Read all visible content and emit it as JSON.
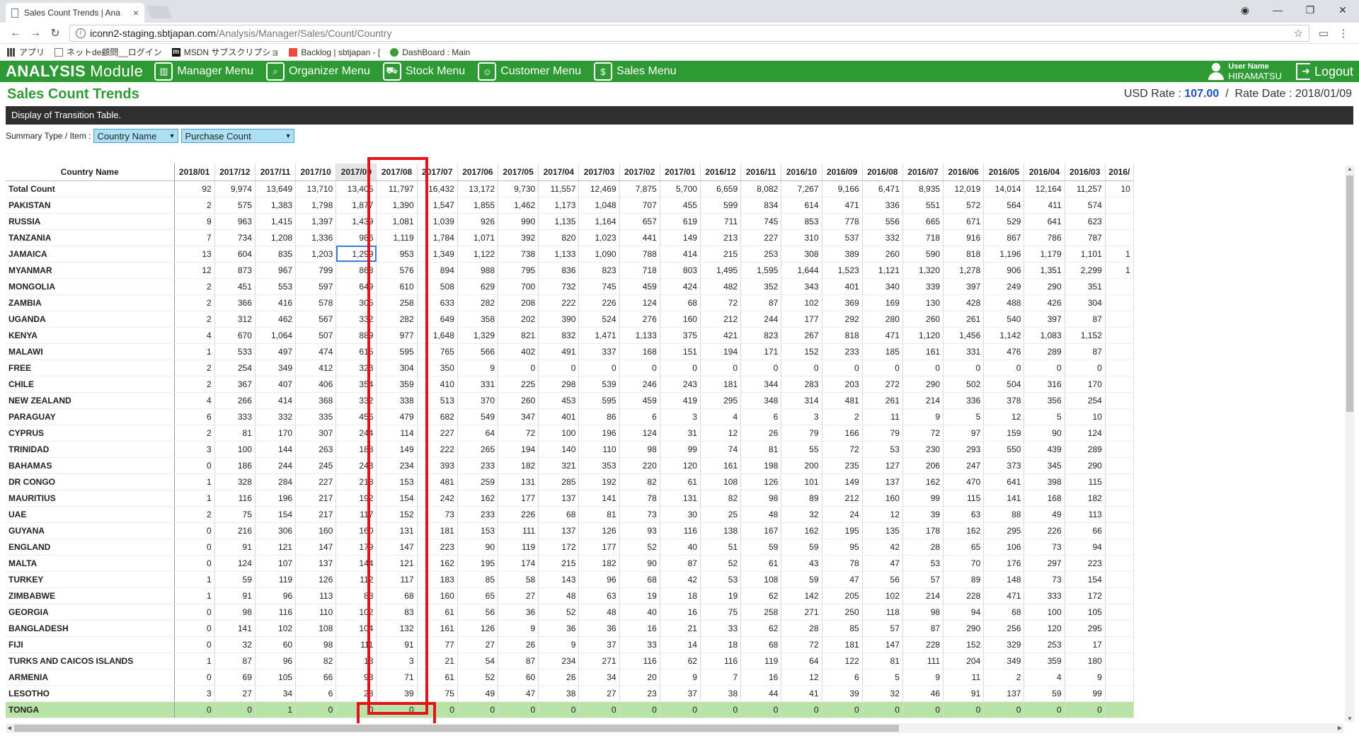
{
  "browser": {
    "tab_title": "Sales Count Trends | Ana",
    "tab_close": "×",
    "url_host": "iconn2-staging.sbtjapan.com",
    "url_path": "/Analysis/Manager/Sales/Count/Country",
    "bookmarks": [
      "アプリ",
      "ネットde顧問__ログイン",
      "MSDN サブスクリプショ",
      "Backlog | sbtjapan - [",
      "DashBoard : Main"
    ]
  },
  "app": {
    "brand": "ANALYSIS",
    "brand_sub": "Module",
    "menu": [
      "Manager Menu",
      "Organizer Menu",
      "Stock Menu",
      "Customer Menu",
      "Sales Menu"
    ],
    "user_label": "User Name",
    "user_name": "HIRAMATSU",
    "logout": "Logout"
  },
  "page": {
    "title": "Sales Count Trends",
    "usd_label": "USD Rate :",
    "usd_value": "107.00",
    "separator": "/",
    "rate_date_label": "Rate Date :",
    "rate_date_value": "2018/01/09",
    "banner": "Display of Transition Table.",
    "summary_label": "Summary Type / Item :",
    "summary_type": "Country Name",
    "summary_item": "Purchase Count"
  },
  "table": {
    "country_header": "Country Name",
    "columns": [
      "2018/01",
      "2017/12",
      "2017/11",
      "2017/10",
      "2017/09",
      "2017/08",
      "2017/07",
      "2017/06",
      "2017/05",
      "2017/04",
      "2017/03",
      "2017/02",
      "2017/01",
      "2016/12",
      "2016/11",
      "2016/10",
      "2016/09",
      "2016/08",
      "2016/07",
      "2016/06",
      "2016/05",
      "2016/04",
      "2016/03",
      "2016/"
    ],
    "rows": [
      {
        "name": "Total Count",
        "values": [
          "92",
          "9,974",
          "13,649",
          "13,710",
          "13,405",
          "11,797",
          "16,432",
          "13,172",
          "9,730",
          "11,557",
          "12,469",
          "7,875",
          "5,700",
          "6,659",
          "8,082",
          "7,267",
          "9,166",
          "6,471",
          "8,935",
          "12,019",
          "14,014",
          "12,164",
          "11,257",
          "10"
        ]
      },
      {
        "name": "PAKISTAN",
        "values": [
          "2",
          "575",
          "1,383",
          "1,798",
          "1,877",
          "1,390",
          "1,547",
          "1,855",
          "1,462",
          "1,173",
          "1,048",
          "707",
          "455",
          "599",
          "834",
          "614",
          "471",
          "336",
          "551",
          "572",
          "564",
          "411",
          "574",
          ""
        ]
      },
      {
        "name": "RUSSIA",
        "values": [
          "9",
          "963",
          "1,415",
          "1,397",
          "1,439",
          "1,081",
          "1,039",
          "926",
          "990",
          "1,135",
          "1,164",
          "657",
          "619",
          "711",
          "745",
          "853",
          "778",
          "556",
          "665",
          "671",
          "529",
          "641",
          "623",
          ""
        ]
      },
      {
        "name": "TANZANIA",
        "values": [
          "7",
          "734",
          "1,208",
          "1,336",
          "986",
          "1,119",
          "1,784",
          "1,071",
          "392",
          "820",
          "1,023",
          "441",
          "149",
          "213",
          "227",
          "310",
          "537",
          "332",
          "718",
          "916",
          "867",
          "786",
          "787",
          ""
        ]
      },
      {
        "name": "JAMAICA",
        "values": [
          "13",
          "604",
          "835",
          "1,203",
          "1,299",
          "953",
          "1,349",
          "1,122",
          "738",
          "1,133",
          "1,090",
          "788",
          "414",
          "215",
          "253",
          "308",
          "389",
          "260",
          "590",
          "818",
          "1,196",
          "1,179",
          "1,101",
          "1"
        ]
      },
      {
        "name": "MYANMAR",
        "values": [
          "12",
          "873",
          "967",
          "799",
          "868",
          "576",
          "894",
          "988",
          "795",
          "836",
          "823",
          "718",
          "803",
          "1,495",
          "1,595",
          "1,644",
          "1,523",
          "1,121",
          "1,320",
          "1,278",
          "906",
          "1,351",
          "2,299",
          "1"
        ]
      },
      {
        "name": "MONGOLIA",
        "values": [
          "2",
          "451",
          "553",
          "597",
          "649",
          "610",
          "508",
          "629",
          "700",
          "732",
          "745",
          "459",
          "424",
          "482",
          "352",
          "343",
          "401",
          "340",
          "339",
          "397",
          "249",
          "290",
          "351",
          ""
        ]
      },
      {
        "name": "ZAMBIA",
        "values": [
          "2",
          "366",
          "416",
          "578",
          "305",
          "258",
          "633",
          "282",
          "208",
          "222",
          "226",
          "124",
          "68",
          "72",
          "87",
          "102",
          "369",
          "169",
          "130",
          "428",
          "488",
          "426",
          "304",
          ""
        ]
      },
      {
        "name": "UGANDA",
        "values": [
          "2",
          "312",
          "462",
          "567",
          "332",
          "282",
          "649",
          "358",
          "202",
          "390",
          "524",
          "276",
          "160",
          "212",
          "244",
          "177",
          "292",
          "280",
          "260",
          "261",
          "540",
          "397",
          "87",
          ""
        ]
      },
      {
        "name": "KENYA",
        "values": [
          "4",
          "670",
          "1,064",
          "507",
          "889",
          "977",
          "1,648",
          "1,329",
          "821",
          "832",
          "1,471",
          "1,133",
          "375",
          "421",
          "823",
          "267",
          "818",
          "471",
          "1,120",
          "1,456",
          "1,142",
          "1,083",
          "1,152",
          ""
        ]
      },
      {
        "name": "MALAWI",
        "values": [
          "1",
          "533",
          "497",
          "474",
          "615",
          "595",
          "765",
          "566",
          "402",
          "491",
          "337",
          "168",
          "151",
          "194",
          "171",
          "152",
          "233",
          "185",
          "161",
          "331",
          "476",
          "289",
          "87",
          ""
        ]
      },
      {
        "name": "FREE",
        "values": [
          "2",
          "254",
          "349",
          "412",
          "323",
          "304",
          "350",
          "9",
          "0",
          "0",
          "0",
          "0",
          "0",
          "0",
          "0",
          "0",
          "0",
          "0",
          "0",
          "0",
          "0",
          "0",
          "0",
          ""
        ]
      },
      {
        "name": "CHILE",
        "values": [
          "2",
          "367",
          "407",
          "406",
          "354",
          "359",
          "410",
          "331",
          "225",
          "298",
          "539",
          "246",
          "243",
          "181",
          "344",
          "283",
          "203",
          "272",
          "290",
          "502",
          "504",
          "316",
          "170",
          ""
        ]
      },
      {
        "name": "NEW ZEALAND",
        "values": [
          "4",
          "266",
          "414",
          "368",
          "332",
          "338",
          "513",
          "370",
          "260",
          "453",
          "595",
          "459",
          "419",
          "295",
          "348",
          "314",
          "481",
          "261",
          "214",
          "336",
          "378",
          "356",
          "254",
          ""
        ]
      },
      {
        "name": "PARAGUAY",
        "values": [
          "6",
          "333",
          "332",
          "335",
          "456",
          "479",
          "682",
          "549",
          "347",
          "401",
          "86",
          "6",
          "3",
          "4",
          "6",
          "3",
          "2",
          "11",
          "9",
          "5",
          "12",
          "5",
          "10",
          ""
        ]
      },
      {
        "name": "CYPRUS",
        "values": [
          "2",
          "81",
          "170",
          "307",
          "244",
          "114",
          "227",
          "64",
          "72",
          "100",
          "196",
          "124",
          "31",
          "12",
          "26",
          "79",
          "166",
          "79",
          "72",
          "97",
          "159",
          "90",
          "124",
          ""
        ]
      },
      {
        "name": "TRINIDAD",
        "values": [
          "3",
          "100",
          "144",
          "263",
          "188",
          "149",
          "222",
          "265",
          "194",
          "140",
          "110",
          "98",
          "99",
          "74",
          "81",
          "55",
          "72",
          "53",
          "230",
          "293",
          "550",
          "439",
          "289",
          ""
        ]
      },
      {
        "name": "BAHAMAS",
        "values": [
          "0",
          "186",
          "244",
          "245",
          "243",
          "234",
          "393",
          "233",
          "182",
          "321",
          "353",
          "220",
          "120",
          "161",
          "198",
          "200",
          "235",
          "127",
          "206",
          "247",
          "373",
          "345",
          "290",
          ""
        ]
      },
      {
        "name": "DR CONGO",
        "values": [
          "1",
          "328",
          "284",
          "227",
          "218",
          "153",
          "481",
          "259",
          "131",
          "285",
          "192",
          "82",
          "61",
          "108",
          "126",
          "101",
          "149",
          "137",
          "162",
          "470",
          "641",
          "398",
          "115",
          ""
        ]
      },
      {
        "name": "MAURITIUS",
        "values": [
          "1",
          "116",
          "196",
          "217",
          "192",
          "154",
          "242",
          "162",
          "177",
          "137",
          "141",
          "78",
          "131",
          "82",
          "98",
          "89",
          "212",
          "160",
          "99",
          "115",
          "141",
          "168",
          "182",
          ""
        ]
      },
      {
        "name": "UAE",
        "values": [
          "2",
          "75",
          "154",
          "217",
          "117",
          "152",
          "73",
          "233",
          "226",
          "68",
          "81",
          "73",
          "30",
          "25",
          "48",
          "32",
          "24",
          "12",
          "39",
          "63",
          "88",
          "49",
          "113",
          ""
        ]
      },
      {
        "name": "GUYANA",
        "values": [
          "0",
          "216",
          "306",
          "160",
          "160",
          "131",
          "181",
          "153",
          "111",
          "137",
          "126",
          "93",
          "116",
          "138",
          "167",
          "162",
          "195",
          "135",
          "178",
          "162",
          "295",
          "226",
          "66",
          ""
        ]
      },
      {
        "name": "ENGLAND",
        "values": [
          "0",
          "91",
          "121",
          "147",
          "179",
          "147",
          "223",
          "90",
          "119",
          "172",
          "177",
          "52",
          "40",
          "51",
          "59",
          "59",
          "95",
          "42",
          "28",
          "65",
          "106",
          "73",
          "94",
          ""
        ]
      },
      {
        "name": "MALTA",
        "values": [
          "0",
          "124",
          "107",
          "137",
          "144",
          "121",
          "162",
          "195",
          "174",
          "215",
          "182",
          "90",
          "87",
          "52",
          "61",
          "43",
          "78",
          "47",
          "53",
          "70",
          "176",
          "297",
          "223",
          ""
        ]
      },
      {
        "name": "TURKEY",
        "values": [
          "1",
          "59",
          "119",
          "126",
          "112",
          "117",
          "183",
          "85",
          "58",
          "143",
          "96",
          "68",
          "42",
          "53",
          "108",
          "59",
          "47",
          "56",
          "57",
          "89",
          "148",
          "73",
          "154",
          ""
        ]
      },
      {
        "name": "ZIMBABWE",
        "values": [
          "1",
          "91",
          "96",
          "113",
          "88",
          "68",
          "160",
          "65",
          "27",
          "48",
          "63",
          "19",
          "18",
          "19",
          "62",
          "142",
          "205",
          "102",
          "214",
          "228",
          "471",
          "333",
          "172",
          ""
        ]
      },
      {
        "name": "GEORGIA",
        "values": [
          "0",
          "98",
          "116",
          "110",
          "102",
          "83",
          "61",
          "56",
          "36",
          "52",
          "48",
          "40",
          "16",
          "75",
          "258",
          "271",
          "250",
          "118",
          "98",
          "94",
          "68",
          "100",
          "105",
          ""
        ]
      },
      {
        "name": "BANGLADESH",
        "values": [
          "0",
          "141",
          "102",
          "108",
          "104",
          "132",
          "161",
          "126",
          "9",
          "36",
          "36",
          "16",
          "21",
          "33",
          "62",
          "28",
          "85",
          "57",
          "87",
          "290",
          "256",
          "120",
          "295",
          ""
        ]
      },
      {
        "name": "FIJI",
        "values": [
          "0",
          "32",
          "60",
          "98",
          "111",
          "91",
          "77",
          "27",
          "26",
          "9",
          "37",
          "33",
          "14",
          "18",
          "68",
          "72",
          "181",
          "147",
          "228",
          "152",
          "329",
          "253",
          "17",
          ""
        ]
      },
      {
        "name": "TURKS AND CAICOS ISLANDS",
        "values": [
          "1",
          "87",
          "96",
          "82",
          "13",
          "3",
          "21",
          "54",
          "87",
          "234",
          "271",
          "116",
          "62",
          "116",
          "119",
          "64",
          "122",
          "81",
          "111",
          "204",
          "349",
          "359",
          "180",
          ""
        ]
      },
      {
        "name": "ARMENIA",
        "values": [
          "0",
          "69",
          "105",
          "66",
          "93",
          "71",
          "61",
          "52",
          "60",
          "26",
          "34",
          "20",
          "9",
          "7",
          "16",
          "12",
          "6",
          "5",
          "9",
          "11",
          "2",
          "4",
          "9",
          ""
        ]
      },
      {
        "name": "LESOTHO",
        "values": [
          "3",
          "27",
          "34",
          "6",
          "28",
          "39",
          "75",
          "49",
          "47",
          "38",
          "27",
          "23",
          "37",
          "38",
          "44",
          "41",
          "39",
          "32",
          "46",
          "91",
          "137",
          "59",
          "99",
          ""
        ]
      },
      {
        "name": "TONGA",
        "values": [
          "0",
          "0",
          "1",
          "0",
          "0",
          "0",
          "0",
          "0",
          "0",
          "0",
          "0",
          "0",
          "0",
          "0",
          "0",
          "0",
          "0",
          "0",
          "0",
          "0",
          "0",
          "0",
          "0",
          ""
        ]
      }
    ]
  },
  "colors": {
    "brand_green": "#2e9a33",
    "title_green": "#2e9a33",
    "rate_blue": "#1f4fbf",
    "highlight_red": "#e4131b",
    "row_green": "#b8e3a6",
    "select_blue": "#aee0f5"
  },
  "icons": {
    "menu": [
      "chart-icon",
      "clipboard-search-icon",
      "car-icon",
      "users-icon",
      "dollar-gear-icon"
    ]
  }
}
